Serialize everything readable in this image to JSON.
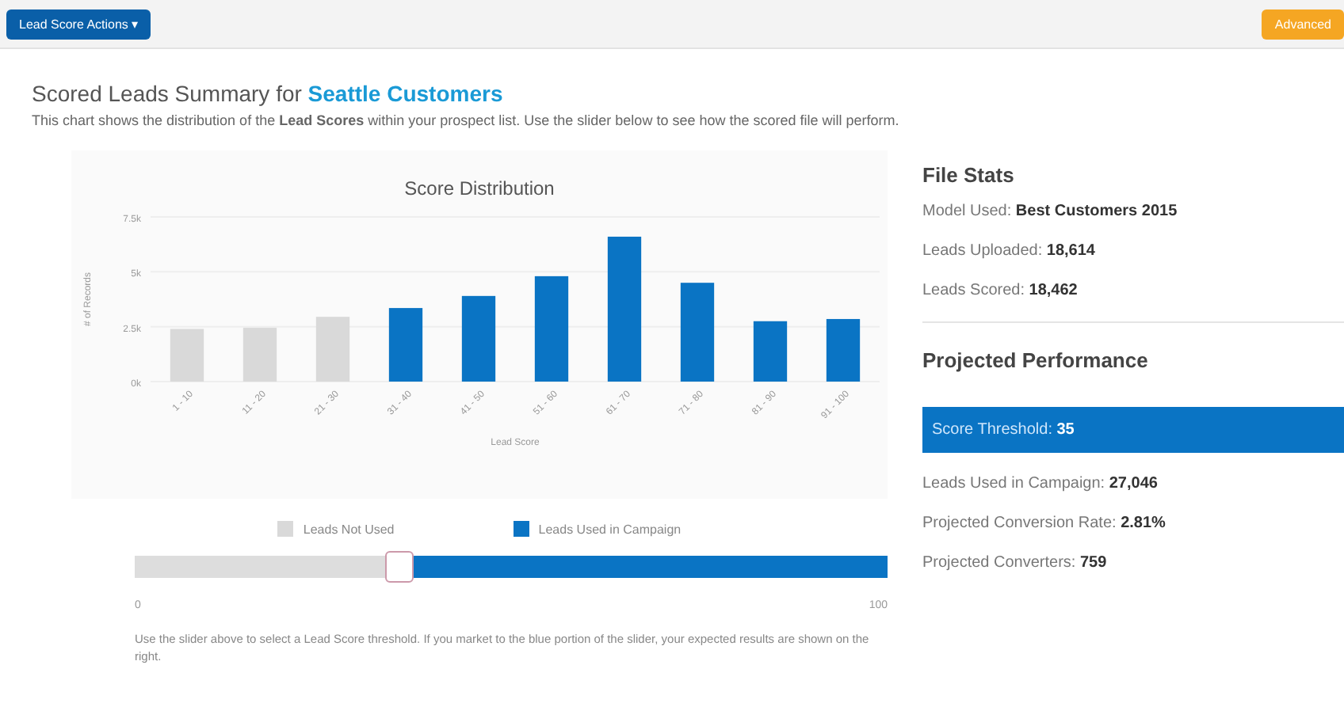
{
  "toolbar": {
    "actions_button": "Lead Score Actions ▾",
    "right_button": "Advanced"
  },
  "header": {
    "title_prefix": "Scored Leads Summary for ",
    "list_name": "Seattle Customers",
    "description": "This chart shows the distribution of the **Lead Scores** within your prospect list. Use the slider below to see how the scored file will perform."
  },
  "chart": {
    "chart_data": {
      "type": "bar",
      "title": "Score Distribution",
      "xlabel": "Lead Score",
      "ylabel": "# of Records",
      "categories": [
        "1 - 10",
        "11 - 20",
        "21 - 30",
        "31 - 40",
        "41 - 50",
        "51 - 60",
        "61 - 70",
        "71 - 80",
        "81 - 90",
        "91 - 100"
      ],
      "series": [
        {
          "name": "Leads Not Used",
          "color": "#d9d9d9",
          "values": [
            2400,
            2450,
            2950,
            null,
            null,
            null,
            null,
            null,
            null,
            null
          ]
        },
        {
          "name": "Leads Used in Campaign",
          "color": "#0a74c4",
          "values": [
            null,
            null,
            null,
            3350,
            3900,
            4800,
            6600,
            4500,
            2750,
            2850
          ]
        }
      ],
      "ylim": [
        0,
        7500
      ],
      "yticks": [
        {
          "value": 0,
          "label": "0k"
        },
        {
          "value": 2500,
          "label": "2.5k"
        },
        {
          "value": 5000,
          "label": "5k"
        },
        {
          "value": 7500,
          "label": "7.5k"
        }
      ]
    }
  },
  "slider": {
    "level": 0.35,
    "min_label": "0",
    "max_label": "100",
    "help": "Use the slider above to select a Lead Score threshold. If you market to the blue portion of the slider, your expected results are shown on the right."
  },
  "file_stats": {
    "title": "File Stats",
    "items": [
      {
        "label": "Model Used: ",
        "value": "Best Customers 2015"
      },
      {
        "label": "Leads Uploaded: ",
        "value": "18,614"
      },
      {
        "label": "Leads Scored: ",
        "value": "18,462"
      }
    ]
  },
  "performance": {
    "title": "Projected Performance",
    "threshold": {
      "label": "Score Threshold: ",
      "value": "35"
    },
    "items": [
      {
        "label": "Leads Used in Campaign: ",
        "value": "27,046"
      },
      {
        "label": "Projected Conversion Rate: ",
        "value": "2.81%"
      },
      {
        "label": "Projected Converters: ",
        "value": "759"
      }
    ]
  }
}
